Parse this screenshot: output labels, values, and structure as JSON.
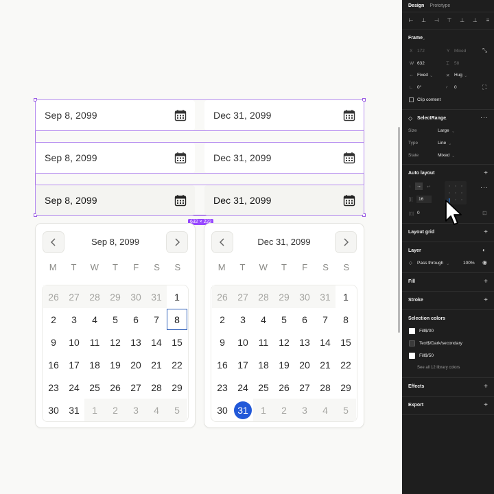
{
  "date_fields": [
    {
      "start": "Sep 8, 2099",
      "end": "Dec 31, 2099"
    },
    {
      "start": "Sep 8, 2099",
      "end": "Dec 31, 2099"
    },
    {
      "start": "Sep 8, 2099",
      "end": "Dec 31, 2099"
    }
  ],
  "size_badge": "632 × 222",
  "weekdays": [
    "M",
    "T",
    "W",
    "T",
    "F",
    "S",
    "S"
  ],
  "calendars": [
    {
      "title": "Sep 8, 2099",
      "days": [
        {
          "d": "26",
          "m": true
        },
        {
          "d": "27",
          "m": true
        },
        {
          "d": "28",
          "m": true
        },
        {
          "d": "29",
          "m": true
        },
        {
          "d": "30",
          "m": true
        },
        {
          "d": "31",
          "m": true
        },
        {
          "d": "1"
        },
        {
          "d": "2"
        },
        {
          "d": "3"
        },
        {
          "d": "4"
        },
        {
          "d": "5"
        },
        {
          "d": "6"
        },
        {
          "d": "7"
        },
        {
          "d": "8",
          "sel": "box"
        },
        {
          "d": "9"
        },
        {
          "d": "10"
        },
        {
          "d": "11"
        },
        {
          "d": "12"
        },
        {
          "d": "13"
        },
        {
          "d": "14"
        },
        {
          "d": "15"
        },
        {
          "d": "16"
        },
        {
          "d": "17"
        },
        {
          "d": "18"
        },
        {
          "d": "19"
        },
        {
          "d": "20"
        },
        {
          "d": "21"
        },
        {
          "d": "22"
        },
        {
          "d": "23"
        },
        {
          "d": "24"
        },
        {
          "d": "25"
        },
        {
          "d": "26"
        },
        {
          "d": "27"
        },
        {
          "d": "28"
        },
        {
          "d": "29"
        },
        {
          "d": "30"
        },
        {
          "d": "31"
        },
        {
          "d": "1",
          "m": true
        },
        {
          "d": "2",
          "m": true
        },
        {
          "d": "3",
          "m": true
        },
        {
          "d": "4",
          "m": true
        },
        {
          "d": "5",
          "m": true
        }
      ]
    },
    {
      "title": "Dec 31, 2099",
      "days": [
        {
          "d": "26",
          "m": true
        },
        {
          "d": "27",
          "m": true
        },
        {
          "d": "28",
          "m": true
        },
        {
          "d": "29",
          "m": true
        },
        {
          "d": "30",
          "m": true
        },
        {
          "d": "31",
          "m": true
        },
        {
          "d": "1"
        },
        {
          "d": "2"
        },
        {
          "d": "3"
        },
        {
          "d": "4"
        },
        {
          "d": "5"
        },
        {
          "d": "6"
        },
        {
          "d": "7"
        },
        {
          "d": "8"
        },
        {
          "d": "9"
        },
        {
          "d": "10"
        },
        {
          "d": "11"
        },
        {
          "d": "12"
        },
        {
          "d": "13"
        },
        {
          "d": "14"
        },
        {
          "d": "15"
        },
        {
          "d": "16"
        },
        {
          "d": "17"
        },
        {
          "d": "18"
        },
        {
          "d": "19"
        },
        {
          "d": "20"
        },
        {
          "d": "21"
        },
        {
          "d": "22"
        },
        {
          "d": "23"
        },
        {
          "d": "24"
        },
        {
          "d": "25"
        },
        {
          "d": "26"
        },
        {
          "d": "27"
        },
        {
          "d": "28"
        },
        {
          "d": "29"
        },
        {
          "d": "30"
        },
        {
          "d": "31",
          "sel": "circle"
        },
        {
          "d": "1",
          "m": true
        },
        {
          "d": "2",
          "m": true
        },
        {
          "d": "3",
          "m": true
        },
        {
          "d": "4",
          "m": true
        },
        {
          "d": "5",
          "m": true
        }
      ]
    }
  ],
  "panel": {
    "tabs": [
      "Design",
      "Prototype"
    ],
    "frame": {
      "heading": "Frame",
      "x_label": "X",
      "x_value": "172",
      "y_label": "Y",
      "y_value": "Mixed",
      "w_label": "W",
      "w_value": "632",
      "h_value": "58",
      "width_mode": "Fixed",
      "height_mode": "Hug",
      "rotation": "0°",
      "radius": "0",
      "clip_content": "Clip content"
    },
    "component": {
      "name": "SelectRange",
      "props": [
        {
          "label": "Size",
          "value": "Large"
        },
        {
          "label": "Type",
          "value": "Line"
        },
        {
          "label": "State",
          "value": "Mixed"
        }
      ]
    },
    "auto_layout": {
      "heading": "Auto layout",
      "gap": "16",
      "padding": "0"
    },
    "layout_grid": "Layout grid",
    "layer": {
      "heading": "Layer",
      "blend": "Pass through",
      "opacity": "100%"
    },
    "fill": "Fill",
    "stroke": "Stroke",
    "selection_colors": {
      "heading": "Selection colors",
      "items": [
        {
          "name": "Fill$/00",
          "color": "#ffffff"
        },
        {
          "name": "Text$/Dark/secondary",
          "color": "#3a3a3a"
        },
        {
          "name": "Fill$/50",
          "color": "#ffffff"
        }
      ],
      "see_all": "See all 12 library colors"
    },
    "effects": "Effects",
    "export": "Export"
  },
  "colors": {
    "selection": "#9747ff",
    "accent": "#2158d8"
  }
}
